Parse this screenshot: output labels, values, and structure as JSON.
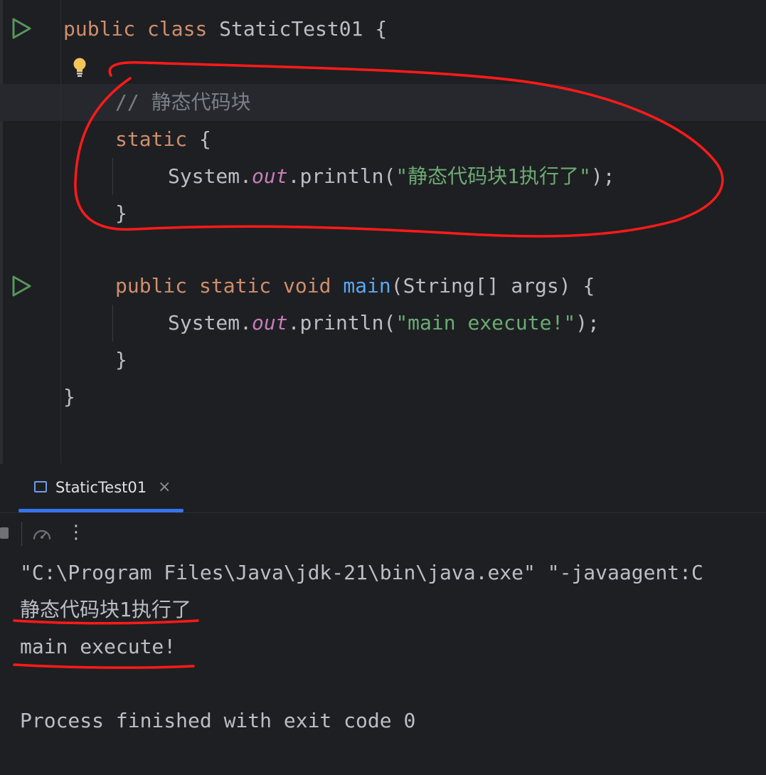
{
  "editor": {
    "lines": {
      "class_decl": {
        "kw1": "public",
        "kw2": "class",
        "name": "StaticTest01",
        "brace": "{"
      },
      "comment": "// 静态代码块",
      "static_block": {
        "kw": "static",
        "brace": "{"
      },
      "static_print": {
        "obj": "System.",
        "field": "out",
        "method": ".println(",
        "str": "\"静态代码块1执行了\"",
        "end": ");"
      },
      "static_close": "}",
      "main_decl": {
        "kw1": "public",
        "kw2": "static",
        "kw3": "void",
        "fn": "main",
        "rest": "(String[] args) {"
      },
      "main_print": {
        "obj": "System.",
        "field": "out",
        "method": ".println(",
        "str": "\"main execute!\"",
        "end": ");"
      },
      "main_close": "}",
      "class_close": "}"
    },
    "icons": {
      "run": "run-icon",
      "intention": "lightbulb-icon"
    }
  },
  "toolwindow": {
    "tab": {
      "label": "StaticTest01",
      "close": "×"
    },
    "toolbar": {
      "more": "⋮"
    },
    "console": [
      "\"C:\\Program Files\\Java\\jdk-21\\bin\\java.exe\" \"-javaagent:C",
      "静态代码块1执行了",
      "main execute!",
      "",
      "Process finished with exit code 0"
    ]
  },
  "colors": {
    "keyword": "#cf8e6d",
    "function": "#56a8f5",
    "string": "#6aab73",
    "static_field": "#c77dbb",
    "comment": "#7a7e85",
    "annotation": "#ff1a1a",
    "tab_accent": "#3574f0"
  }
}
